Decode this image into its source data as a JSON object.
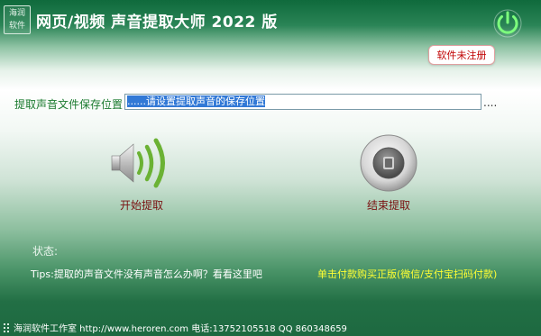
{
  "app": {
    "logo_line1": "海润",
    "logo_line2": "软件",
    "title": "网页/视频 声音提取大师 2022 版"
  },
  "register_button": "软件未注册",
  "save": {
    "label": "提取声音文件保存位置",
    "value": "......请设置提取声音的保存位置",
    "browse": "...."
  },
  "start_label": "开始提取",
  "stop_label": "结束提取",
  "status_label": "状态:",
  "tips_text": "Tips:提取的声音文件没有声音怎么办啊？看看这里吧",
  "buy_text": "单击付款购买正版(微信/支付宝扫码付款)",
  "footer_text": "海润软件工作室 http://www.heroren.com  电话:13752105518  QQ 860348659",
  "colors": {
    "brand_green": "#1d6940",
    "label_green": "#1a7a2e",
    "register_red": "#c00000",
    "buy_yellow": "#ffff33"
  }
}
